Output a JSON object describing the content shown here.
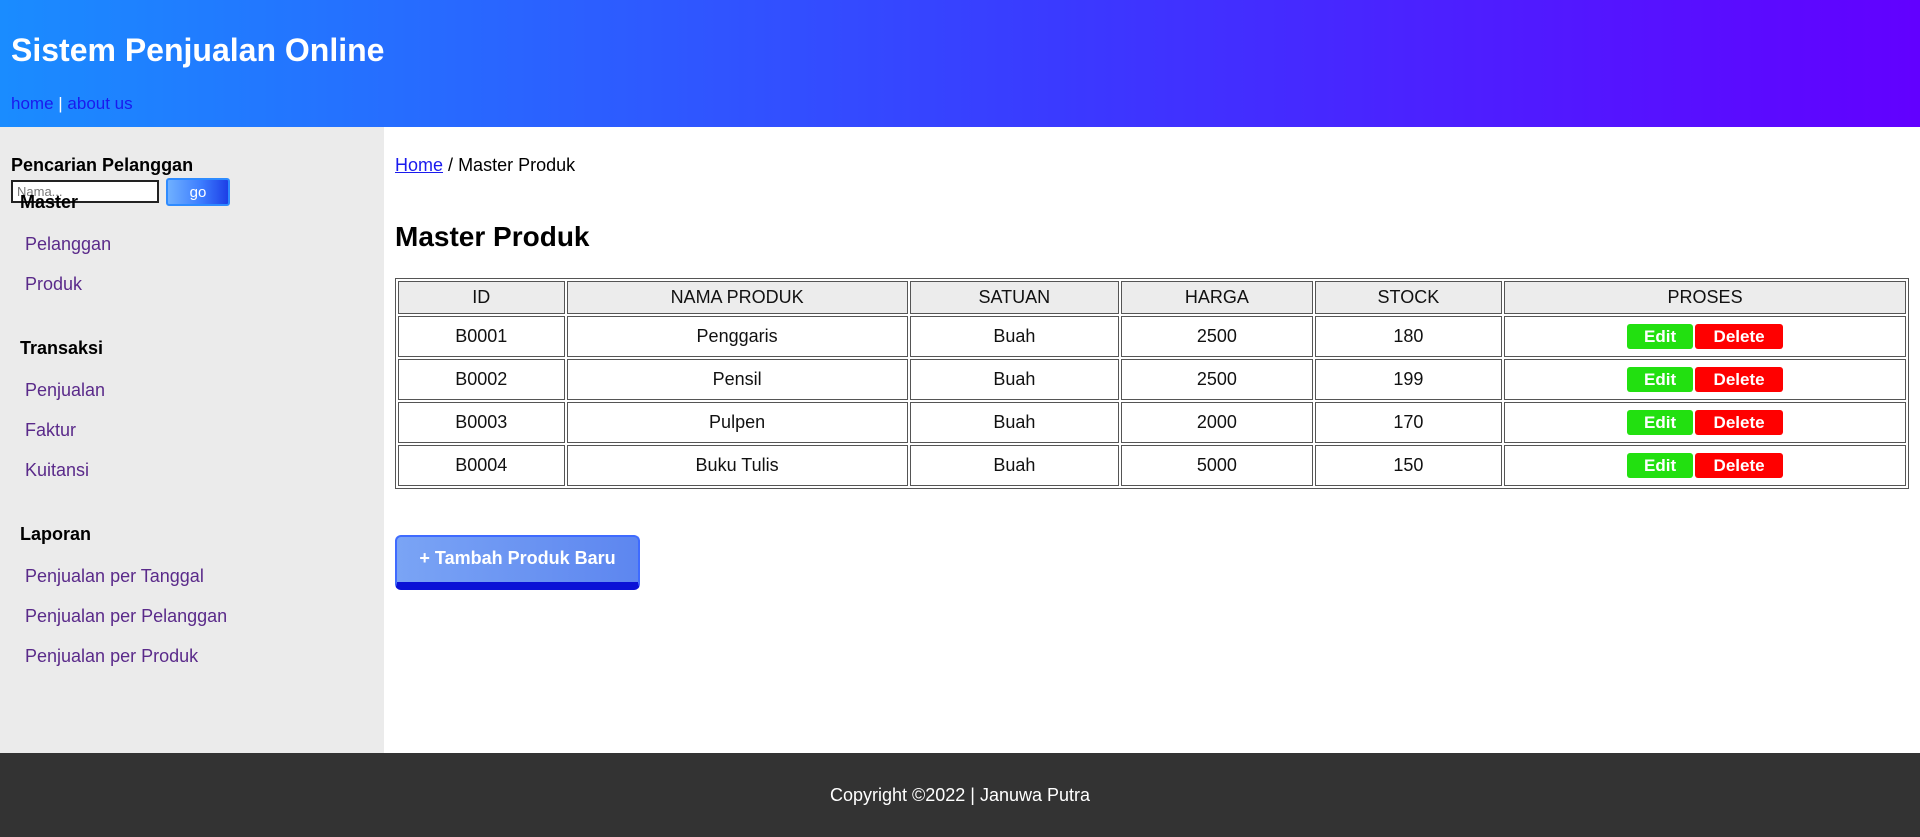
{
  "header": {
    "title": "Sistem Penjualan Online",
    "nav": {
      "home": "home",
      "separator": "|",
      "about": "about us"
    },
    "colors": {
      "gradient_start": "#1a8cff",
      "gradient_end": "#6200ff"
    }
  },
  "sidebar": {
    "search": {
      "title": "Pencarian Pelanggan",
      "placeholder": "Nama...",
      "value": "",
      "button_label": "go"
    },
    "sections": [
      {
        "heading": "Master",
        "links": [
          "Pelanggan",
          "Produk"
        ]
      },
      {
        "heading": "Transaksi",
        "links": [
          "Penjualan",
          "Faktur",
          "Kuitansi"
        ]
      },
      {
        "heading": "Laporan",
        "links": [
          "Penjualan per Tanggal",
          "Penjualan per Pelanggan",
          "Penjualan per Produk"
        ]
      }
    ]
  },
  "main": {
    "breadcrumb": {
      "home": "Home",
      "separator": "/",
      "current": "Master Produk"
    },
    "title": "Master Produk",
    "table": {
      "headers": [
        "ID",
        "NAMA PRODUK",
        "SATUAN",
        "HARGA",
        "STOCK",
        "PROSES"
      ],
      "rows": [
        {
          "id": "B0001",
          "nama": "Penggaris",
          "satuan": "Buah",
          "harga": "2500",
          "stock": "180"
        },
        {
          "id": "B0002",
          "nama": "Pensil",
          "satuan": "Buah",
          "harga": "2500",
          "stock": "199"
        },
        {
          "id": "B0003",
          "nama": "Pulpen",
          "satuan": "Buah",
          "harga": "2000",
          "stock": "170"
        },
        {
          "id": "B0004",
          "nama": "Buku Tulis",
          "satuan": "Buah",
          "harga": "5000",
          "stock": "150"
        }
      ],
      "edit_label": "Edit",
      "delete_label": "Delete",
      "colors": {
        "edit": "#22e010",
        "delete": "#ff0000"
      }
    },
    "add_button_label": "+ Tambah Produk Baru"
  },
  "footer": {
    "text": "Copyright ©2022 | Januwa Putra"
  }
}
